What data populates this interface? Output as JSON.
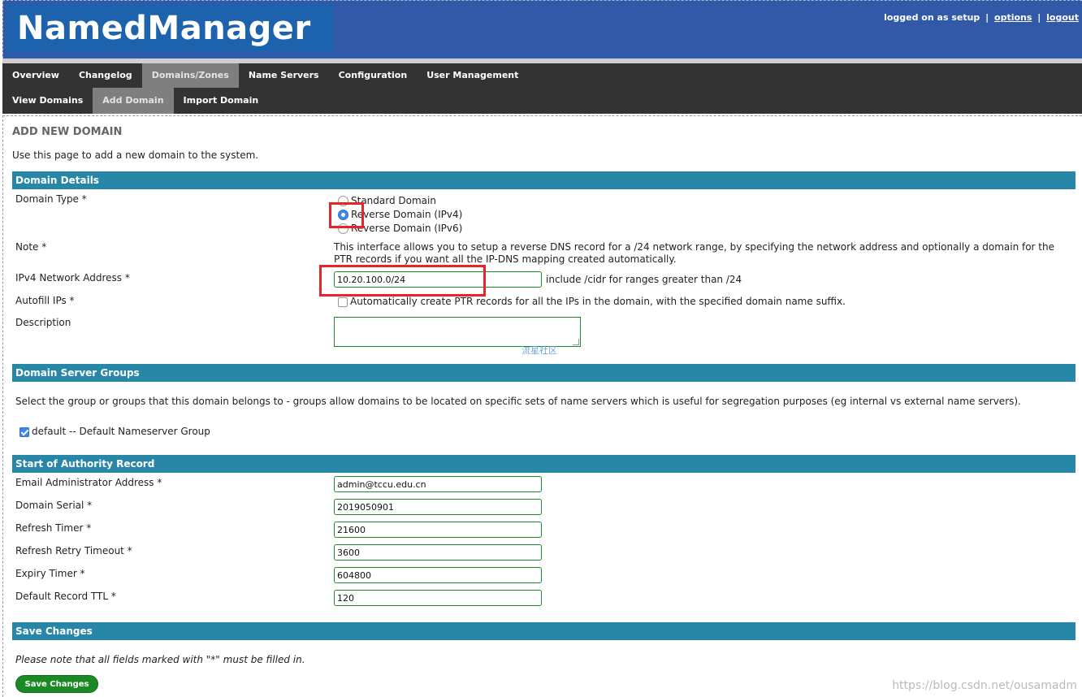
{
  "header": {
    "logo": "NamedManager",
    "logged_on": "logged on as setup",
    "sep": "|",
    "options": "options",
    "logout": "logout"
  },
  "nav_primary": [
    "Overview",
    "Changelog",
    "Domains/Zones",
    "Name Servers",
    "Configuration",
    "User Management"
  ],
  "nav_secondary": [
    "View Domains",
    "Add Domain",
    "Import Domain"
  ],
  "page": {
    "title": "ADD NEW DOMAIN",
    "intro": "Use this page to add a new domain to the system."
  },
  "domain_details": {
    "heading": "Domain Details",
    "domain_type_label": "Domain Type *",
    "types": [
      "Standard Domain",
      "Reverse Domain (IPv4)",
      "Reverse Domain (IPv6)"
    ],
    "selected_type": "Reverse Domain (IPv4)",
    "note_label": "Note *",
    "note_text": "This interface allows you to setup a reverse DNS record for a /24 network range, by specifying the network address and optionally a domain for the PTR records if you want all the IP-DNS mapping created automatically.",
    "ipv4_label": "IPv4 Network Address *",
    "ipv4_value": "10.20.100.0/24",
    "ipv4_hint": "include /cidr for ranges greater than /24",
    "autofill_label": "Autofill IPs *",
    "autofill_text": "Automatically create PTR records for all the IPs in the domain, with the specified domain name suffix.",
    "description_label": "Description"
  },
  "server_groups": {
    "heading": "Domain Server Groups",
    "text": "Select the group or groups that this domain belongs to - groups allow domains to be located on specific sets of name servers which is useful for segregation purposes (eg internal vs external name servers).",
    "group_label": "default -- Default Nameserver Group"
  },
  "soa": {
    "heading": "Start of Authority Record",
    "fields": [
      {
        "label": "Email Administrator Address *",
        "value": "admin@tccu.edu.cn"
      },
      {
        "label": "Domain Serial *",
        "value": "2019050901"
      },
      {
        "label": "Refresh Timer *",
        "value": "21600"
      },
      {
        "label": "Refresh Retry Timeout *",
        "value": "3600"
      },
      {
        "label": "Expiry Timer *",
        "value": "604800"
      },
      {
        "label": "Default Record TTL *",
        "value": "120"
      }
    ]
  },
  "save": {
    "heading": "Save Changes",
    "note": "Please note that all fields marked with \"*\" must be filled in.",
    "button": "Save Changes"
  },
  "watermarks": {
    "cn": "流星社区",
    "url": "https://blog.csdn.net/ousamadm"
  },
  "colors": {
    "header_bg": "#3259a7",
    "logo_bg": "#1d62ad",
    "nav_bg": "#333333",
    "section_bg": "#2886a6",
    "save_button": "#1a8a24",
    "highlight_box": "#e8232a"
  }
}
